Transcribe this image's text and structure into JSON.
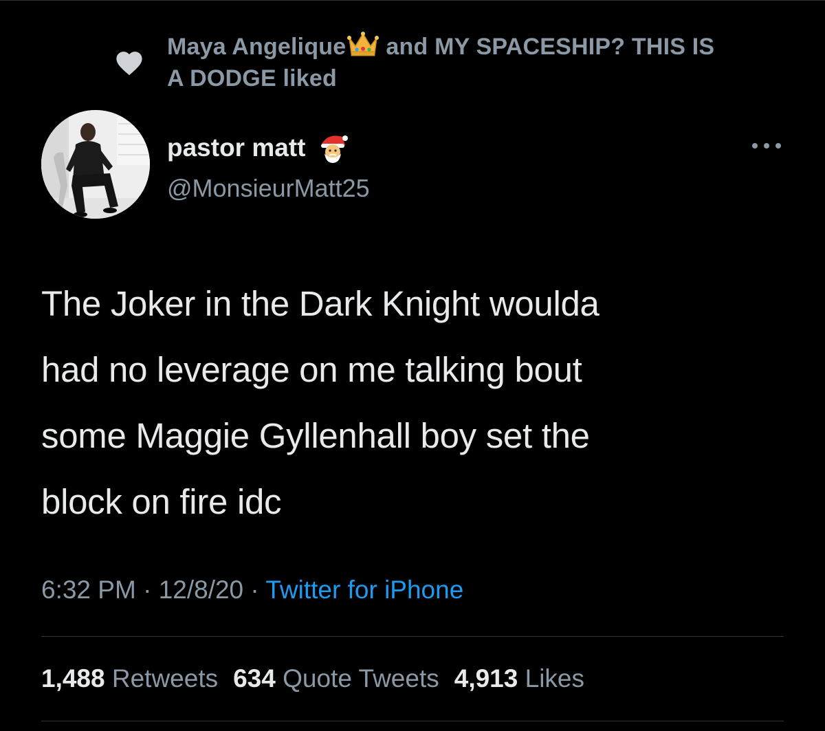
{
  "social_context": {
    "user1": "Maya Angelique",
    "user1_emoji": "crown-icon",
    "connector": "and",
    "user2_prefix": "MY SPACESHIP? THIS IS",
    "user2_suffix": "A DODGE",
    "action": "liked",
    "icon": "heart-icon"
  },
  "author": {
    "display_name": "pastor matt",
    "display_emoji": "santa-icon",
    "handle": "@MonsieurMatt25",
    "avatar": "avatar"
  },
  "tweet": {
    "text": "The Joker in the Dark Knight woulda\nhad no leverage on me talking bout\nsome Maggie Gyllenhall boy set the\nblock on fire idc"
  },
  "meta": {
    "time": "6:32 PM",
    "separator": "·",
    "date": "12/8/20",
    "source": "Twitter for iPhone"
  },
  "stats": {
    "retweets_count": "1,488",
    "retweets_label": "Retweets",
    "quotes_count": "634",
    "quotes_label": "Quote Tweets",
    "likes_count": "4,913",
    "likes_label": "Likes"
  },
  "colors": {
    "background": "#000000",
    "text_primary": "#e7e9ea",
    "text_secondary": "#8b98a5",
    "link": "#1d9bf0",
    "divider": "#2f3336"
  }
}
